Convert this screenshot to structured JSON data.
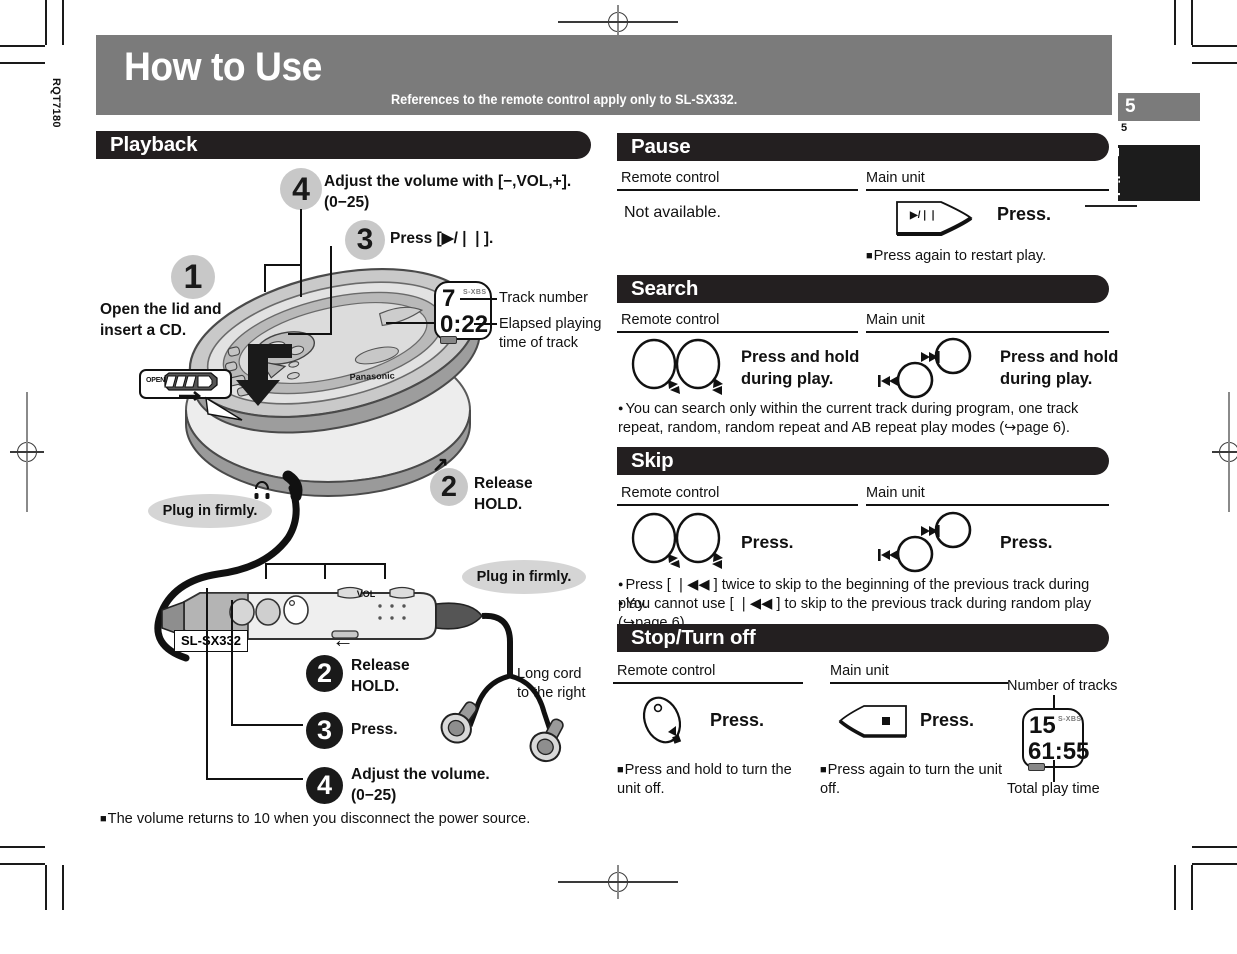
{
  "page": {
    "doc_code": "RQT7180",
    "page_number": "5",
    "page_number_small": "5",
    "language_tab": "English"
  },
  "masthead": {
    "title": "How to Use",
    "subtitle": "References to the remote control apply only to SL-SX332."
  },
  "playback": {
    "heading": "Playback",
    "steps": [
      {
        "num": "1",
        "label": "Open the lid and\ninsert a CD."
      },
      {
        "num": "4",
        "label": "Adjust the volume with [−,VOL,+].\n(0−25)"
      },
      {
        "num": "3",
        "label": "Press [▶/❘❘]."
      },
      {
        "num": "2",
        "label": "Release\nHOLD."
      }
    ],
    "remote_steps": [
      {
        "num": "2",
        "label": "Release\nHOLD."
      },
      {
        "num": "3",
        "label": "Press."
      },
      {
        "num": "4",
        "label": "Adjust the volume.\n(0−25)"
      }
    ],
    "callouts": [
      "Plug in firmly.",
      "Plug in firmly."
    ],
    "open_label": "OPEN",
    "model_label": "SL-SX332",
    "cord_label": "Long cord\nto the right",
    "display": {
      "track_number": "7",
      "xbs": "S-XBS",
      "elapsed_time": "0:22",
      "track_number_caption": "Track number",
      "elapsed_caption": "Elapsed playing\ntime of track"
    },
    "footnote": "The volume returns to 10 when you disconnect the power source."
  },
  "pause": {
    "heading": "Pause",
    "col_remote": "Remote control",
    "col_main": "Main unit",
    "remote_text": "Not available.",
    "main_button_label": "▶/❘❘",
    "main_action": "Press.",
    "note": "Press again to restart play."
  },
  "search": {
    "heading": "Search",
    "col_remote": "Remote control",
    "col_main": "Main unit",
    "remote_action": "Press and hold\nduring play.",
    "main_action": "Press and hold\nduring play.",
    "main_labels": {
      "forward": "▶▶❘",
      "back": "❘◀◀"
    },
    "note": "You can search only within the current track during program, one track repeat, random, random repeat and AB repeat play modes (↪page 6)."
  },
  "skip": {
    "heading": "Skip",
    "col_remote": "Remote control",
    "col_main": "Main unit",
    "remote_action": "Press.",
    "main_action": "Press.",
    "main_labels": {
      "forward": "▶▶❘",
      "back": "❘◀◀"
    },
    "notes": [
      "Press [ ❘◀◀ ] twice to skip to the beginning of the previous track during play.",
      "You cannot use [ ❘◀◀ ] to skip to the previous track during random play (↪page 6)."
    ]
  },
  "stop": {
    "heading": "Stop/Turn off",
    "col_remote": "Remote control",
    "col_main": "Main unit",
    "remote_action": "Press.",
    "main_action": "Press.",
    "remote_note": "Press and hold to turn the\nunit off.",
    "main_note": "Press again to turn the unit\noff.",
    "display": {
      "tracks_caption": "Number of tracks",
      "tracks": "15",
      "xbs": "S-XBS",
      "total_time": "61:55",
      "total_caption": "Total play time"
    }
  },
  "colors": {
    "masthead_gray": "#7b7b7b",
    "section_black": "#231f20",
    "step_gray": "#c8c8c8",
    "step_black": "#1a1a1a",
    "callout_gray": "#d5d5d5"
  }
}
